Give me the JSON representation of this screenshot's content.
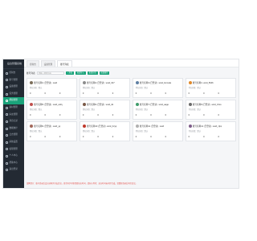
{
  "app": {
    "title": "后台管理系统"
  },
  "sidebar": {
    "items": [
      {
        "label": "控制台"
      },
      {
        "label": "账号管理"
      },
      {
        "label": "设备管理"
      },
      {
        "label": "任务管理"
      },
      {
        "label": "群组管理"
      },
      {
        "label": "素材管理"
      },
      {
        "label": "好友管理"
      },
      {
        "label": "消息记录"
      },
      {
        "label": "数据统计"
      },
      {
        "label": "日志管理"
      },
      {
        "label": "系统设置"
      },
      {
        "label": "权限管理"
      },
      {
        "label": "个人中心"
      },
      {
        "label": "帮助中心"
      },
      {
        "label": "退出登录"
      }
    ]
  },
  "topbar": {
    "tabs": [
      {
        "label": "控制台"
      },
      {
        "label": "设备管理"
      },
      {
        "label": "账号列表"
      }
    ]
  },
  "toolbar": {
    "label": "账号列表",
    "search_placeholder": "请输入搜索内容",
    "buttons": [
      {
        "label": "+ 添加"
      },
      {
        "label": "批量导入"
      },
      {
        "label": "批量分组"
      },
      {
        "label": "批量操作"
      }
    ]
  },
  "colors": {
    "accent": "#1aa37a",
    "sidebar": "#232a33",
    "warning": "#e2504b"
  },
  "cards": [
    {
      "name": "账号名称1 (已登录) ·wxid",
      "meta": "所在分组：默认",
      "stats": [
        "0",
        "0",
        "0"
      ],
      "avatar": "#7d6e5a"
    },
    {
      "name": "账号名称2 (已登录) ·wxid_027",
      "meta": "所在分组：默认",
      "stats": [
        "0",
        "0",
        "0"
      ],
      "avatar": "#8c8c8c"
    },
    {
      "name": "账号名称3 (已登录) ·wxid_bonvale",
      "meta": "所在分组：默认",
      "stats": [
        "0",
        "0",
        "0"
      ],
      "avatar": "#5e7fa3"
    },
    {
      "name": "账号名称4 ·wxid_5646",
      "meta": "所在分组：默认",
      "stats": [
        "0",
        "0",
        "0"
      ],
      "avatar": "#e08a2c"
    },
    {
      "name": "账号名称5 (已登录) ·wxid_wshy",
      "meta": "所在分组：默认",
      "stats": [
        "0",
        "0",
        "0"
      ],
      "avatar": "#c0504d"
    },
    {
      "name": "账号名称6 (已登录) ·wxid_dk",
      "meta": "所在分组：默认",
      "stats": [
        "0",
        "0",
        "0"
      ],
      "avatar": "#7a5a48"
    },
    {
      "name": "账号名称7 (已登录) ·wxid_aage",
      "meta": "所在分组：默认",
      "stats": [
        "0",
        "0",
        "0"
      ],
      "avatar": "#3f9b6b"
    },
    {
      "name": "账号名称8 (已登录) ·wxid_3zso",
      "meta": "所在分组：默认",
      "stats": [
        "0",
        "0",
        "0"
      ],
      "avatar": "#6a6a6a"
    },
    {
      "name": "账号名称9 (已登录) ·wxid_yq",
      "meta": "所在分组：默认",
      "stats": [
        "0",
        "0",
        "0"
      ],
      "avatar": "#a3685a"
    },
    {
      "name": "账号名称10 (已登录) ·wxid_hzyq",
      "meta": "所在分组：默认",
      "stats": [
        "0",
        "0",
        "0"
      ],
      "avatar": "#c0392b"
    },
    {
      "name": "账号名称11 (已登录) ·wxid",
      "meta": "所在分组：默认",
      "stats": [
        "0",
        "0",
        "0"
      ],
      "avatar": "#b0b0b0"
    },
    {
      "name": "账号名称12 (已登录) ·wxid_zlpq",
      "meta": "所在分组：默认",
      "stats": [
        "0",
        "0",
        "0"
      ],
      "avatar": "#7e5d8a"
    }
  ],
  "notice": "温馨提示：账号登录后会自动同步好友信息，首次同步可能需要较长时间，请耐心等待；如长时间未同步完成，请重新登录后再次尝试。"
}
